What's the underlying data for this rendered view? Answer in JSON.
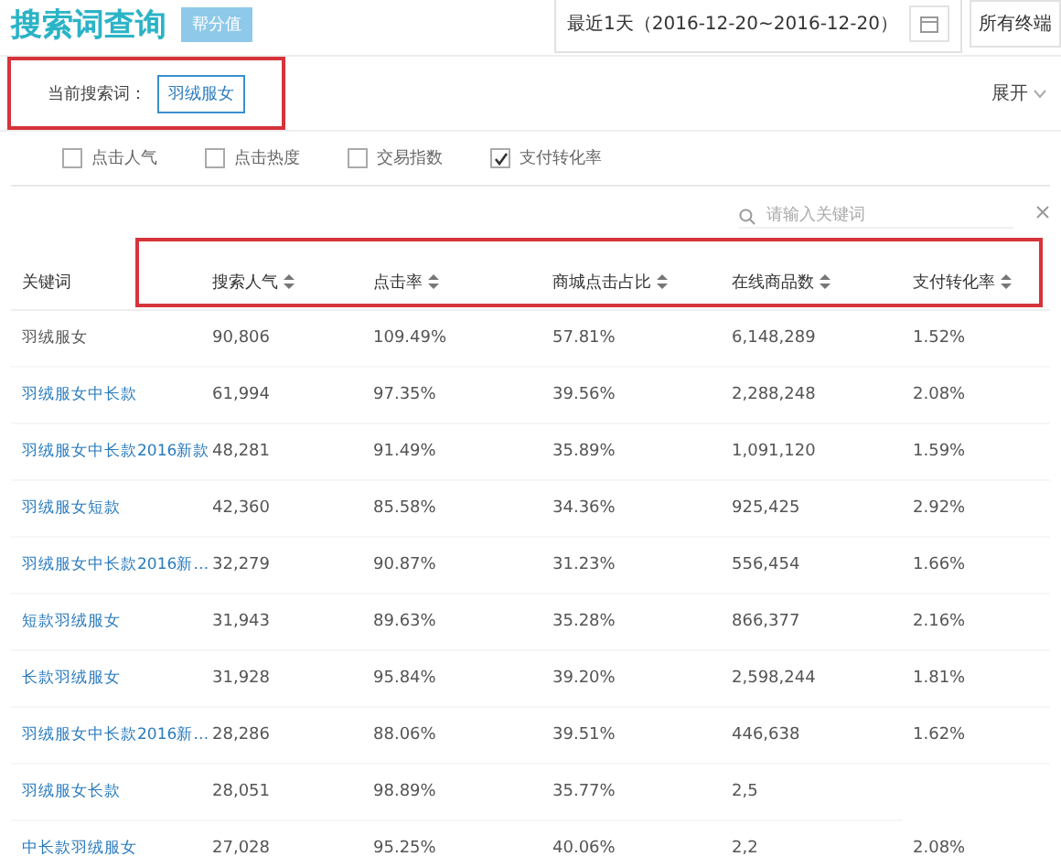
{
  "header": {
    "title": "搜索词查询",
    "badge": "帮分值",
    "date_range": "最近1天（2016-12-20~2016-12-20）",
    "device": "所有终端"
  },
  "current_search": {
    "label": "当前搜索词：",
    "value": "羽绒服女",
    "highlighted": true,
    "expand": "展开"
  },
  "metrics": [
    {
      "label": "点击人气",
      "checked": false
    },
    {
      "label": "点击热度",
      "checked": false
    },
    {
      "label": "交易指数",
      "checked": false
    },
    {
      "label": "支付转化率",
      "checked": true
    }
  ],
  "search": {
    "placeholder": "请输入关键词"
  },
  "table": {
    "header_highlighted": true,
    "columns": [
      {
        "label": "关键词",
        "sortable": false
      },
      {
        "label": "搜索人气",
        "sortable": true
      },
      {
        "label": "点击率",
        "sortable": true
      },
      {
        "label": "商城点击占比",
        "sortable": true
      },
      {
        "label": "在线商品数",
        "sortable": true
      },
      {
        "label": "支付转化率",
        "sortable": true
      }
    ],
    "rows": [
      {
        "link": false,
        "cells": [
          "羽绒服女",
          "90,806",
          "109.49%",
          "57.81%",
          "6,148,289",
          "1.52%"
        ]
      },
      {
        "link": true,
        "cells": [
          "羽绒服女中长款",
          "61,994",
          "97.35%",
          "39.56%",
          "2,288,248",
          "2.08%"
        ]
      },
      {
        "link": true,
        "cells": [
          "羽绒服女中长款2016新款",
          "48,281",
          "91.49%",
          "35.89%",
          "1,091,120",
          "1.59%"
        ]
      },
      {
        "link": true,
        "cells": [
          "羽绒服女短款",
          "42,360",
          "85.58%",
          "34.36%",
          "925,425",
          "2.92%"
        ]
      },
      {
        "link": true,
        "cells": [
          "羽绒服女中长款2016新…",
          "32,279",
          "90.87%",
          "31.23%",
          "556,454",
          "1.66%"
        ]
      },
      {
        "link": true,
        "cells": [
          "短款羽绒服女",
          "31,943",
          "89.63%",
          "35.28%",
          "866,377",
          "2.16%"
        ]
      },
      {
        "link": true,
        "cells": [
          "长款羽绒服女",
          "31,928",
          "95.84%",
          "39.20%",
          "2,598,244",
          "1.81%"
        ]
      },
      {
        "link": true,
        "cells": [
          "羽绒服女中长款2016新…",
          "28,286",
          "88.06%",
          "39.51%",
          "446,638",
          "1.62%"
        ]
      },
      {
        "link": true,
        "cells": [
          "羽绒服女长款",
          "28,051",
          "98.89%",
          "35.77%",
          "2,5"
        ]
      },
      {
        "link": true,
        "cells": [
          "中长款羽绒服女",
          "27,028",
          "95.25%",
          "40.06%",
          "2,2",
          "2.08%"
        ]
      }
    ]
  }
}
